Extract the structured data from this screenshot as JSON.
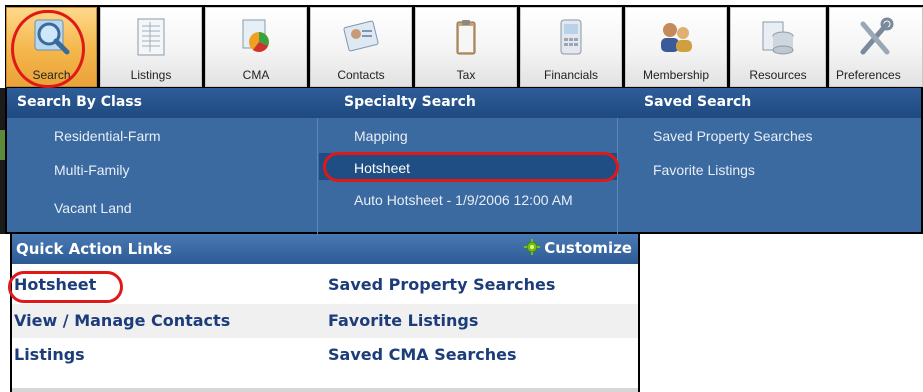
{
  "toolbar": {
    "buttons": [
      {
        "label": "Search",
        "icon": "search-icon",
        "active": true
      },
      {
        "label": "Listings",
        "icon": "listings-icon"
      },
      {
        "label": "CMA",
        "icon": "cma-icon"
      },
      {
        "label": "Contacts",
        "icon": "contacts-icon"
      },
      {
        "label": "Tax",
        "icon": "tax-icon"
      },
      {
        "label": "Financials",
        "icon": "financials-icon"
      },
      {
        "label": "Membership",
        "icon": "membership-icon"
      },
      {
        "label": "Resources",
        "icon": "resources-icon"
      },
      {
        "label": "Preferences",
        "icon": "preferences-icon"
      }
    ]
  },
  "menu": {
    "columns": [
      {
        "heading": "Search By Class",
        "items": [
          "Residential-Farm",
          "Multi-Family",
          "Vacant Land"
        ]
      },
      {
        "heading": "Specialty Search",
        "items": [
          "Mapping",
          "Hotsheet",
          "Auto Hotsheet - 1/9/2006 12:00 AM"
        ]
      },
      {
        "heading": "Saved Search",
        "items": [
          "Saved Property Searches",
          "Favorite Listings"
        ]
      }
    ],
    "selected_item": "Hotsheet"
  },
  "quick_actions": {
    "title": "Quick Action Links",
    "customize_label": "Customize",
    "rows": [
      {
        "left": "Hotsheet",
        "right": "Saved Property Searches"
      },
      {
        "left": "View / Manage Contacts",
        "right": "Favorite Listings"
      },
      {
        "left": "Listings",
        "right": "Saved CMA Searches"
      }
    ]
  },
  "colors": {
    "menu_header": "#1e4a80",
    "menu_body": "#3a6aa0",
    "link_text": "#1d3d7a",
    "highlight_ring": "#e01818",
    "active_button": "#f4b64a"
  }
}
